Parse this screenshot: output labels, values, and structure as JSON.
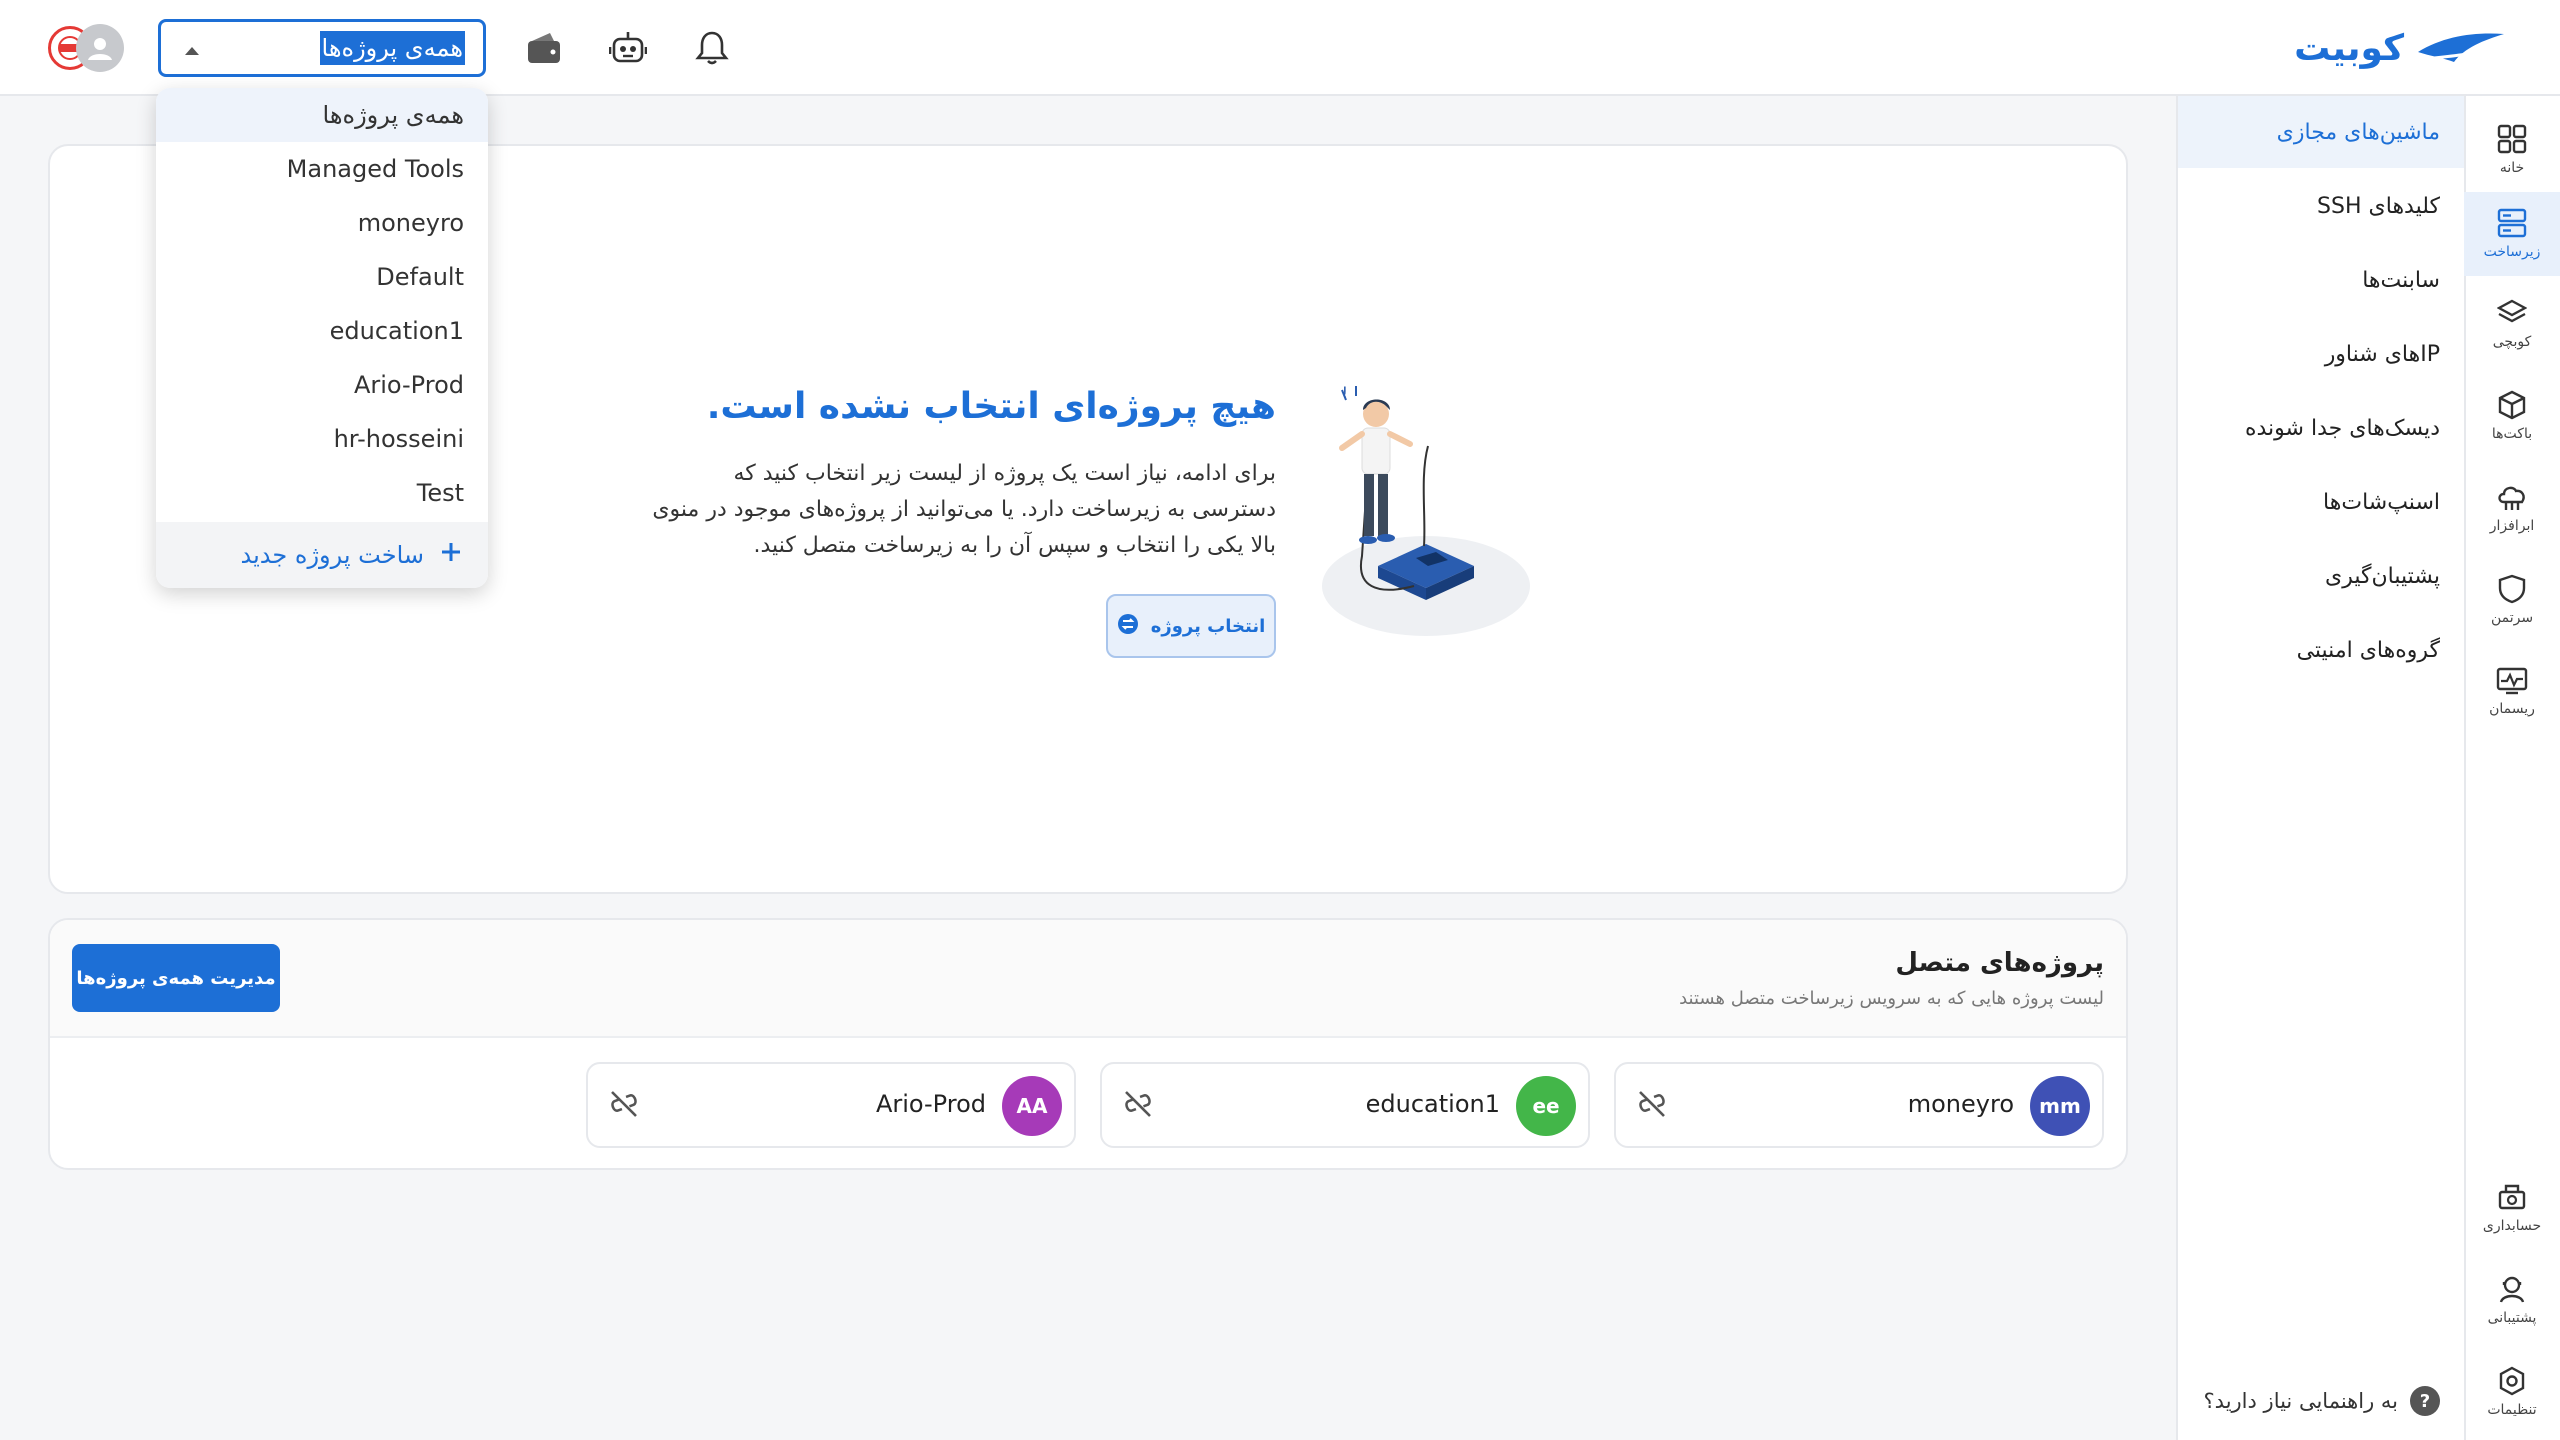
{
  "header": {
    "logo_text": "کوبیت",
    "project_select": {
      "value": "همه‌ی پروژه‌ها"
    },
    "icons": [
      "bell-icon",
      "robot-icon",
      "wallet-icon",
      "user-avatar-icon"
    ]
  },
  "dropdown": {
    "options": [
      {
        "label": "همه‌ی پروژه‌ها",
        "active": true
      },
      {
        "label": "Managed Tools"
      },
      {
        "label": "moneyro"
      },
      {
        "label": "Default"
      },
      {
        "label": "education1"
      },
      {
        "label": "Ario-Prod"
      },
      {
        "label": "hr-hosseini"
      },
      {
        "label": "Test"
      }
    ],
    "new_project_label": "ساخت پروژه جدید"
  },
  "rail": {
    "items": [
      {
        "label": "خانه",
        "icon": "grid-icon"
      },
      {
        "label": "زیرساخت",
        "icon": "server-icon",
        "active": true
      },
      {
        "label": "کوبچی",
        "icon": "layers-icon"
      },
      {
        "label": "باکت‌ها",
        "icon": "cube-icon"
      },
      {
        "label": "ابرافزار",
        "icon": "cloud-app-icon"
      },
      {
        "label": "سرتمن",
        "icon": "shield-icon"
      },
      {
        "label": "ریسمان",
        "icon": "monitor-pulse-icon"
      }
    ],
    "bottom_items": [
      {
        "label": "حسابداری",
        "icon": "accounting-icon"
      },
      {
        "label": "پشتیبانی",
        "icon": "support-icon"
      },
      {
        "label": "تنظیمات",
        "icon": "settings-icon"
      }
    ]
  },
  "menu": {
    "items": [
      {
        "label": "ماشین‌های مجازی",
        "active": true
      },
      {
        "label": "کلیدهای SSH"
      },
      {
        "label": "سابنت‌ها"
      },
      {
        "label": "IPهای شناور"
      },
      {
        "label": "دیسک‌های جدا شونده"
      },
      {
        "label": "اسنپ‌شات‌ها"
      },
      {
        "label": "پشتیبان‌گیری"
      },
      {
        "label": "گروه‌های امنیتی"
      }
    ],
    "help_label": "به راهنمایی نیاز دارید؟",
    "help_glyph": "?"
  },
  "empty_state": {
    "title": "هیچ پروژه‌ای انتخاب نشده است.",
    "description": "برای ادامه، نیاز است یک پروژه از لیست زیر انتخاب کنید که دسترسی به زیرساخت دارد. یا می‌توانید از پروژه‌های موجود در منوی بالا یکی را انتخاب و سپس آن را به زیرساخت متصل کنید.",
    "button_label": "انتخاب پروژه"
  },
  "connected_projects": {
    "title": "پروژه‌های متصل",
    "subtitle": "لیست پروژه هایی که به سرویس زیرساخت متصل هستند",
    "manage_label": "مدیریت همه‌ی پروژه‌ها",
    "projects": [
      {
        "name": "moneyro",
        "initials": "mm",
        "color": "#3f51b5"
      },
      {
        "name": "education1",
        "initials": "ee",
        "color": "#43b649"
      },
      {
        "name": "Ario-Prod",
        "initials": "AA",
        "color": "#a63ab8"
      }
    ]
  },
  "colors": {
    "accent": "#1d6fd6",
    "border": "#e6e8ec"
  }
}
